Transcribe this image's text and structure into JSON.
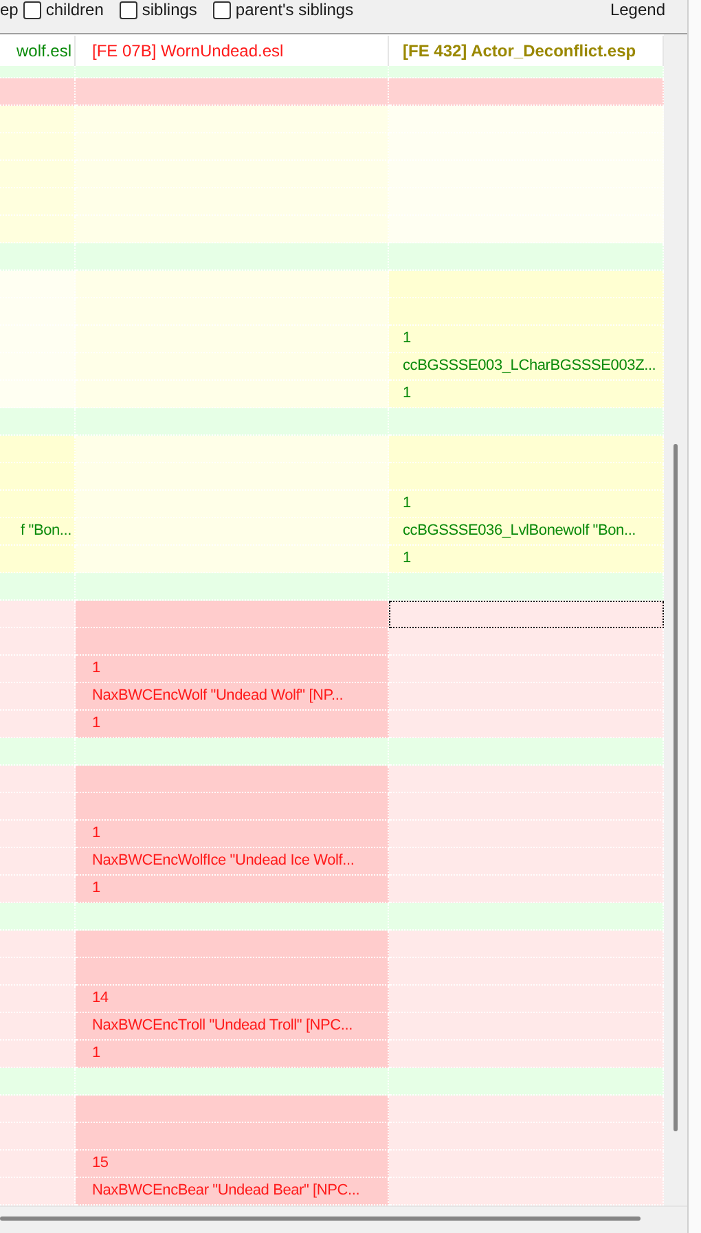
{
  "toolbar": {
    "leading_text": "ep",
    "checkboxes": [
      {
        "label": "children",
        "checked": false
      },
      {
        "label": "siblings",
        "checked": false
      },
      {
        "label": "parent's siblings",
        "checked": false
      }
    ],
    "legend_button": "Legend"
  },
  "columns": [
    {
      "label": "wolf.esl",
      "color": "#0a8a0a"
    },
    {
      "label": "[FE 07B] WornUndead.esl",
      "color": "#ff1a1a"
    },
    {
      "label": "[FE 432] Actor_Deconflict.esp",
      "color": "#9a8800"
    }
  ],
  "rows": [
    {
      "kind": "group",
      "focused": false,
      "cells": [
        {
          "kind": "pale"
        },
        {
          "kind": "pale"
        },
        {
          "kind": "pale"
        }
      ]
    },
    {
      "kind": "conflict",
      "focused": false,
      "cells": [
        {
          "kind": "mid"
        },
        {
          "kind": "mid"
        },
        {
          "kind": "mid"
        }
      ]
    },
    {
      "kind": "override",
      "focused": false,
      "cells": [
        {
          "kind": "mid"
        },
        {
          "kind": "light"
        },
        {
          "kind": "pale"
        }
      ]
    },
    {
      "kind": "override",
      "focused": false,
      "cells": [
        {
          "kind": "mid"
        },
        {
          "kind": "light"
        },
        {
          "kind": "pale"
        }
      ]
    },
    {
      "kind": "override",
      "focused": false,
      "cells": [
        {
          "kind": "mid"
        },
        {
          "kind": "light"
        },
        {
          "kind": "pale"
        }
      ]
    },
    {
      "kind": "override",
      "focused": false,
      "cells": [
        {
          "kind": "mid"
        },
        {
          "kind": "light"
        },
        {
          "kind": "pale"
        }
      ]
    },
    {
      "kind": "override",
      "focused": false,
      "cells": [
        {
          "kind": "mid"
        },
        {
          "kind": "light"
        },
        {
          "kind": "pale"
        }
      ]
    },
    {
      "kind": "group",
      "focused": false,
      "cells": [
        {
          "kind": "pale"
        },
        {
          "kind": "pale"
        },
        {
          "kind": "pale"
        }
      ]
    },
    {
      "kind": "override",
      "focused": false,
      "cells": [
        {
          "kind": "pale"
        },
        {
          "kind": "light"
        },
        {
          "kind": "strong"
        }
      ]
    },
    {
      "kind": "override",
      "focused": false,
      "cells": [
        {
          "kind": "pale"
        },
        {
          "kind": "light"
        },
        {
          "kind": "strong"
        }
      ]
    },
    {
      "kind": "override",
      "focused": false,
      "cells": [
        {
          "kind": "pale"
        },
        {
          "kind": "light"
        },
        {
          "kind": "strong",
          "text": "1"
        }
      ]
    },
    {
      "kind": "override",
      "focused": false,
      "cells": [
        {
          "kind": "pale"
        },
        {
          "kind": "light"
        },
        {
          "kind": "strong",
          "text": "ccBGSSSE003_LCharBGSSSE003Z..."
        }
      ]
    },
    {
      "kind": "override",
      "focused": false,
      "cells": [
        {
          "kind": "pale"
        },
        {
          "kind": "light"
        },
        {
          "kind": "strong",
          "text": "1"
        }
      ]
    },
    {
      "kind": "group",
      "focused": false,
      "cells": [
        {
          "kind": "pale"
        },
        {
          "kind": "pale"
        },
        {
          "kind": "pale"
        }
      ]
    },
    {
      "kind": "override",
      "focused": false,
      "cells": [
        {
          "kind": "strong"
        },
        {
          "kind": "light"
        },
        {
          "kind": "strong"
        }
      ]
    },
    {
      "kind": "override",
      "focused": false,
      "cells": [
        {
          "kind": "strong"
        },
        {
          "kind": "light"
        },
        {
          "kind": "strong"
        }
      ]
    },
    {
      "kind": "override",
      "focused": false,
      "cells": [
        {
          "kind": "strong"
        },
        {
          "kind": "light"
        },
        {
          "kind": "strong",
          "text": "1"
        }
      ]
    },
    {
      "kind": "override",
      "focused": false,
      "cells": [
        {
          "kind": "strong",
          "text": "f \"Bon..."
        },
        {
          "kind": "light"
        },
        {
          "kind": "strong",
          "text": "ccBGSSSE036_LvlBonewolf \"Bon..."
        }
      ]
    },
    {
      "kind": "override",
      "focused": false,
      "cells": [
        {
          "kind": "strong"
        },
        {
          "kind": "light"
        },
        {
          "kind": "strong",
          "text": "1"
        }
      ]
    },
    {
      "kind": "group",
      "focused": false,
      "cells": [
        {
          "kind": "pale"
        },
        {
          "kind": "pale"
        },
        {
          "kind": "pale"
        }
      ]
    },
    {
      "kind": "conflict",
      "focused": true,
      "cells": [
        {
          "kind": "pale"
        },
        {
          "kind": "strong"
        },
        {
          "kind": "pale"
        }
      ]
    },
    {
      "kind": "conflict",
      "focused": false,
      "cells": [
        {
          "kind": "pale"
        },
        {
          "kind": "strong"
        },
        {
          "kind": "pale"
        }
      ]
    },
    {
      "kind": "conflict",
      "focused": false,
      "cells": [
        {
          "kind": "pale"
        },
        {
          "kind": "strong",
          "text": "1"
        },
        {
          "kind": "pale"
        }
      ]
    },
    {
      "kind": "conflict",
      "focused": false,
      "cells": [
        {
          "kind": "pale"
        },
        {
          "kind": "strong",
          "text": "NaxBWCEncWolf \"Undead Wolf\" [NP..."
        },
        {
          "kind": "pale"
        }
      ]
    },
    {
      "kind": "conflict",
      "focused": false,
      "cells": [
        {
          "kind": "pale"
        },
        {
          "kind": "strong",
          "text": "1"
        },
        {
          "kind": "pale"
        }
      ]
    },
    {
      "kind": "group",
      "focused": false,
      "cells": [
        {
          "kind": "pale"
        },
        {
          "kind": "pale"
        },
        {
          "kind": "pale"
        }
      ]
    },
    {
      "kind": "conflict",
      "focused": false,
      "cells": [
        {
          "kind": "pale"
        },
        {
          "kind": "strong"
        },
        {
          "kind": "pale"
        }
      ]
    },
    {
      "kind": "conflict",
      "focused": false,
      "cells": [
        {
          "kind": "pale"
        },
        {
          "kind": "strong"
        },
        {
          "kind": "pale"
        }
      ]
    },
    {
      "kind": "conflict",
      "focused": false,
      "cells": [
        {
          "kind": "pale"
        },
        {
          "kind": "strong",
          "text": "1"
        },
        {
          "kind": "pale"
        }
      ]
    },
    {
      "kind": "conflict",
      "focused": false,
      "cells": [
        {
          "kind": "pale"
        },
        {
          "kind": "strong",
          "text": "NaxBWCEncWolfIce \"Undead Ice Wolf..."
        },
        {
          "kind": "pale"
        }
      ]
    },
    {
      "kind": "conflict",
      "focused": false,
      "cells": [
        {
          "kind": "pale"
        },
        {
          "kind": "strong",
          "text": "1"
        },
        {
          "kind": "pale"
        }
      ]
    },
    {
      "kind": "group",
      "focused": false,
      "cells": [
        {
          "kind": "pale"
        },
        {
          "kind": "pale"
        },
        {
          "kind": "pale"
        }
      ]
    },
    {
      "kind": "conflict",
      "focused": false,
      "cells": [
        {
          "kind": "pale"
        },
        {
          "kind": "strong"
        },
        {
          "kind": "pale"
        }
      ]
    },
    {
      "kind": "conflict",
      "focused": false,
      "cells": [
        {
          "kind": "pale"
        },
        {
          "kind": "strong"
        },
        {
          "kind": "pale"
        }
      ]
    },
    {
      "kind": "conflict",
      "focused": false,
      "cells": [
        {
          "kind": "pale"
        },
        {
          "kind": "strong",
          "text": "14"
        },
        {
          "kind": "pale"
        }
      ]
    },
    {
      "kind": "conflict",
      "focused": false,
      "cells": [
        {
          "kind": "pale"
        },
        {
          "kind": "strong",
          "text": "NaxBWCEncTroll \"Undead Troll\" [NPC..."
        },
        {
          "kind": "pale"
        }
      ]
    },
    {
      "kind": "conflict",
      "focused": false,
      "cells": [
        {
          "kind": "pale"
        },
        {
          "kind": "strong",
          "text": "1"
        },
        {
          "kind": "pale"
        }
      ]
    },
    {
      "kind": "group",
      "focused": false,
      "cells": [
        {
          "kind": "pale"
        },
        {
          "kind": "pale"
        },
        {
          "kind": "pale"
        }
      ]
    },
    {
      "kind": "conflict",
      "focused": false,
      "cells": [
        {
          "kind": "pale"
        },
        {
          "kind": "strong"
        },
        {
          "kind": "pale"
        }
      ]
    },
    {
      "kind": "conflict",
      "focused": false,
      "cells": [
        {
          "kind": "pale"
        },
        {
          "kind": "strong"
        },
        {
          "kind": "pale"
        }
      ]
    },
    {
      "kind": "conflict",
      "focused": false,
      "cells": [
        {
          "kind": "pale"
        },
        {
          "kind": "strong",
          "text": "15"
        },
        {
          "kind": "pale"
        }
      ]
    },
    {
      "kind": "conflict",
      "focused": false,
      "cells": [
        {
          "kind": "pale"
        },
        {
          "kind": "strong",
          "text": "NaxBWCEncBear \"Undead Bear\" [NPC..."
        },
        {
          "kind": "pale"
        }
      ]
    }
  ]
}
